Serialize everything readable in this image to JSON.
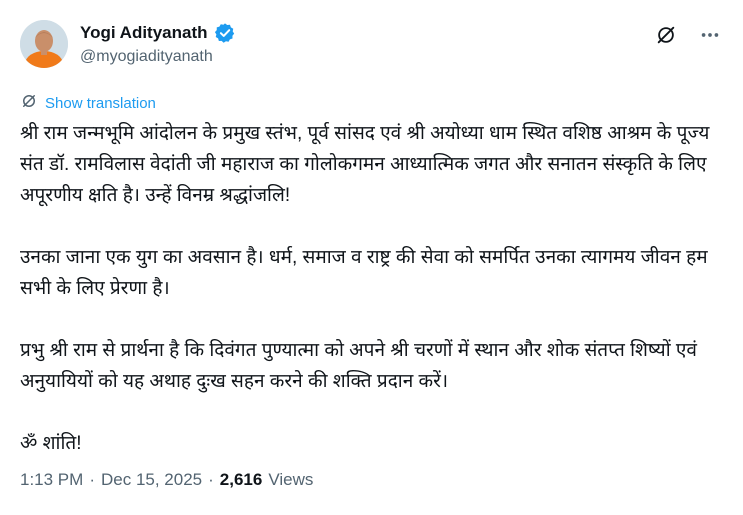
{
  "author": {
    "name": "Yogi Adityanath",
    "handle": "@myogiadityanath"
  },
  "icons": {
    "avatar": "avatar",
    "verified": "verified-badge-icon",
    "grok": "grok-icon",
    "more": "more-options-icon",
    "translate": "translate-icon"
  },
  "colors": {
    "accent": "#1d9bf0",
    "secondary_text": "#536471",
    "primary_text": "#0f1419"
  },
  "translate_label": "Show translation",
  "paragraphs": [
    "श्री राम जन्मभूमि आंदोलन के प्रमुख स्तंभ, पूर्व सांसद एवं श्री अयोध्या धाम स्थित वशिष्ठ आश्रम के पूज्य संत डॉ. रामविलास वेदांती जी महाराज का गोलोकगमन आध्यात्मिक जगत और सनातन संस्कृति के लिए अपूरणीय क्षति है। उन्हें विनम्र श्रद्धांजलि!",
    "उनका जाना एक युग का अवसान है। धर्म, समाज व राष्ट्र की सेवा को समर्पित उनका त्यागमय जीवन हम सभी के लिए प्रेरणा है।",
    "प्रभु श्री राम से प्रार्थना है कि दिवंगत पुण्यात्मा को अपने श्री चरणों में स्थान और शोक संतप्त शिष्यों एवं अनुयायियों को यह अथाह दुःख सहन करने की शक्ति प्रदान करें।",
    "ॐ शांति!"
  ],
  "meta": {
    "time": "1:13 PM",
    "date": "Dec 15, 2025",
    "separator": "·",
    "views_count": "2,616",
    "views_label": "Views"
  }
}
